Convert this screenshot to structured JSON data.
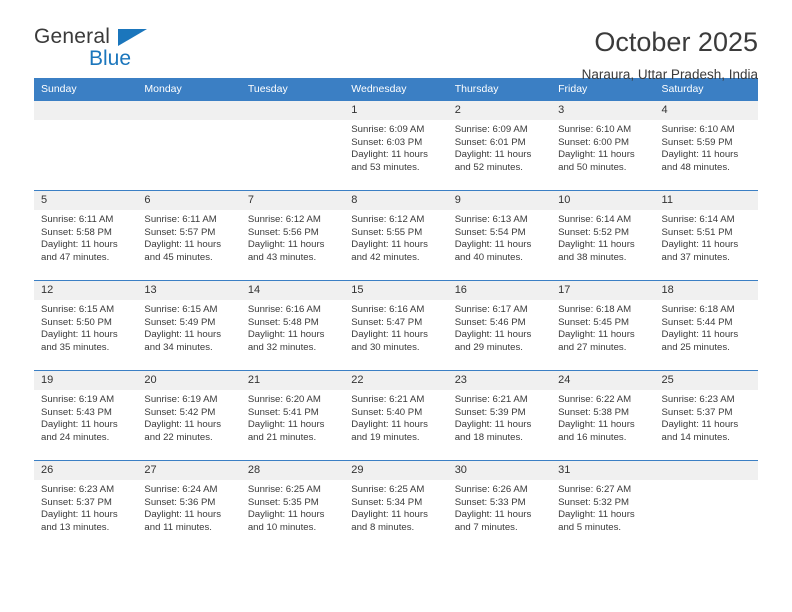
{
  "brand": {
    "name_part1": "General",
    "name_part2": "Blue",
    "triangle_color": "#1b76bc"
  },
  "header": {
    "title": "October 2025",
    "subtitle": "Naraura, Uttar Pradesh, India"
  },
  "theme": {
    "header_blue": "#3b7fc4",
    "daynum_bg": "#f0f0f0",
    "text": "#3a3a3a"
  },
  "weekdays": [
    "Sunday",
    "Monday",
    "Tuesday",
    "Wednesday",
    "Thursday",
    "Friday",
    "Saturday"
  ],
  "labels": {
    "sunrise": "Sunrise:",
    "sunset": "Sunset:",
    "daylight": "Daylight:"
  },
  "weeks": [
    [
      {
        "day": "",
        "sunrise": "",
        "sunset": "",
        "daylight1": "",
        "daylight2": ""
      },
      {
        "day": "",
        "sunrise": "",
        "sunset": "",
        "daylight1": "",
        "daylight2": ""
      },
      {
        "day": "",
        "sunrise": "",
        "sunset": "",
        "daylight1": "",
        "daylight2": ""
      },
      {
        "day": "1",
        "sunrise": "Sunrise: 6:09 AM",
        "sunset": "Sunset: 6:03 PM",
        "daylight1": "Daylight: 11 hours",
        "daylight2": "and 53 minutes."
      },
      {
        "day": "2",
        "sunrise": "Sunrise: 6:09 AM",
        "sunset": "Sunset: 6:01 PM",
        "daylight1": "Daylight: 11 hours",
        "daylight2": "and 52 minutes."
      },
      {
        "day": "3",
        "sunrise": "Sunrise: 6:10 AM",
        "sunset": "Sunset: 6:00 PM",
        "daylight1": "Daylight: 11 hours",
        "daylight2": "and 50 minutes."
      },
      {
        "day": "4",
        "sunrise": "Sunrise: 6:10 AM",
        "sunset": "Sunset: 5:59 PM",
        "daylight1": "Daylight: 11 hours",
        "daylight2": "and 48 minutes."
      }
    ],
    [
      {
        "day": "5",
        "sunrise": "Sunrise: 6:11 AM",
        "sunset": "Sunset: 5:58 PM",
        "daylight1": "Daylight: 11 hours",
        "daylight2": "and 47 minutes."
      },
      {
        "day": "6",
        "sunrise": "Sunrise: 6:11 AM",
        "sunset": "Sunset: 5:57 PM",
        "daylight1": "Daylight: 11 hours",
        "daylight2": "and 45 minutes."
      },
      {
        "day": "7",
        "sunrise": "Sunrise: 6:12 AM",
        "sunset": "Sunset: 5:56 PM",
        "daylight1": "Daylight: 11 hours",
        "daylight2": "and 43 minutes."
      },
      {
        "day": "8",
        "sunrise": "Sunrise: 6:12 AM",
        "sunset": "Sunset: 5:55 PM",
        "daylight1": "Daylight: 11 hours",
        "daylight2": "and 42 minutes."
      },
      {
        "day": "9",
        "sunrise": "Sunrise: 6:13 AM",
        "sunset": "Sunset: 5:54 PM",
        "daylight1": "Daylight: 11 hours",
        "daylight2": "and 40 minutes."
      },
      {
        "day": "10",
        "sunrise": "Sunrise: 6:14 AM",
        "sunset": "Sunset: 5:52 PM",
        "daylight1": "Daylight: 11 hours",
        "daylight2": "and 38 minutes."
      },
      {
        "day": "11",
        "sunrise": "Sunrise: 6:14 AM",
        "sunset": "Sunset: 5:51 PM",
        "daylight1": "Daylight: 11 hours",
        "daylight2": "and 37 minutes."
      }
    ],
    [
      {
        "day": "12",
        "sunrise": "Sunrise: 6:15 AM",
        "sunset": "Sunset: 5:50 PM",
        "daylight1": "Daylight: 11 hours",
        "daylight2": "and 35 minutes."
      },
      {
        "day": "13",
        "sunrise": "Sunrise: 6:15 AM",
        "sunset": "Sunset: 5:49 PM",
        "daylight1": "Daylight: 11 hours",
        "daylight2": "and 34 minutes."
      },
      {
        "day": "14",
        "sunrise": "Sunrise: 6:16 AM",
        "sunset": "Sunset: 5:48 PM",
        "daylight1": "Daylight: 11 hours",
        "daylight2": "and 32 minutes."
      },
      {
        "day": "15",
        "sunrise": "Sunrise: 6:16 AM",
        "sunset": "Sunset: 5:47 PM",
        "daylight1": "Daylight: 11 hours",
        "daylight2": "and 30 minutes."
      },
      {
        "day": "16",
        "sunrise": "Sunrise: 6:17 AM",
        "sunset": "Sunset: 5:46 PM",
        "daylight1": "Daylight: 11 hours",
        "daylight2": "and 29 minutes."
      },
      {
        "day": "17",
        "sunrise": "Sunrise: 6:18 AM",
        "sunset": "Sunset: 5:45 PM",
        "daylight1": "Daylight: 11 hours",
        "daylight2": "and 27 minutes."
      },
      {
        "day": "18",
        "sunrise": "Sunrise: 6:18 AM",
        "sunset": "Sunset: 5:44 PM",
        "daylight1": "Daylight: 11 hours",
        "daylight2": "and 25 minutes."
      }
    ],
    [
      {
        "day": "19",
        "sunrise": "Sunrise: 6:19 AM",
        "sunset": "Sunset: 5:43 PM",
        "daylight1": "Daylight: 11 hours",
        "daylight2": "and 24 minutes."
      },
      {
        "day": "20",
        "sunrise": "Sunrise: 6:19 AM",
        "sunset": "Sunset: 5:42 PM",
        "daylight1": "Daylight: 11 hours",
        "daylight2": "and 22 minutes."
      },
      {
        "day": "21",
        "sunrise": "Sunrise: 6:20 AM",
        "sunset": "Sunset: 5:41 PM",
        "daylight1": "Daylight: 11 hours",
        "daylight2": "and 21 minutes."
      },
      {
        "day": "22",
        "sunrise": "Sunrise: 6:21 AM",
        "sunset": "Sunset: 5:40 PM",
        "daylight1": "Daylight: 11 hours",
        "daylight2": "and 19 minutes."
      },
      {
        "day": "23",
        "sunrise": "Sunrise: 6:21 AM",
        "sunset": "Sunset: 5:39 PM",
        "daylight1": "Daylight: 11 hours",
        "daylight2": "and 18 minutes."
      },
      {
        "day": "24",
        "sunrise": "Sunrise: 6:22 AM",
        "sunset": "Sunset: 5:38 PM",
        "daylight1": "Daylight: 11 hours",
        "daylight2": "and 16 minutes."
      },
      {
        "day": "25",
        "sunrise": "Sunrise: 6:23 AM",
        "sunset": "Sunset: 5:37 PM",
        "daylight1": "Daylight: 11 hours",
        "daylight2": "and 14 minutes."
      }
    ],
    [
      {
        "day": "26",
        "sunrise": "Sunrise: 6:23 AM",
        "sunset": "Sunset: 5:37 PM",
        "daylight1": "Daylight: 11 hours",
        "daylight2": "and 13 minutes."
      },
      {
        "day": "27",
        "sunrise": "Sunrise: 6:24 AM",
        "sunset": "Sunset: 5:36 PM",
        "daylight1": "Daylight: 11 hours",
        "daylight2": "and 11 minutes."
      },
      {
        "day": "28",
        "sunrise": "Sunrise: 6:25 AM",
        "sunset": "Sunset: 5:35 PM",
        "daylight1": "Daylight: 11 hours",
        "daylight2": "and 10 minutes."
      },
      {
        "day": "29",
        "sunrise": "Sunrise: 6:25 AM",
        "sunset": "Sunset: 5:34 PM",
        "daylight1": "Daylight: 11 hours",
        "daylight2": "and 8 minutes."
      },
      {
        "day": "30",
        "sunrise": "Sunrise: 6:26 AM",
        "sunset": "Sunset: 5:33 PM",
        "daylight1": "Daylight: 11 hours",
        "daylight2": "and 7 minutes."
      },
      {
        "day": "31",
        "sunrise": "Sunrise: 6:27 AM",
        "sunset": "Sunset: 5:32 PM",
        "daylight1": "Daylight: 11 hours",
        "daylight2": "and 5 minutes."
      },
      {
        "day": "",
        "sunrise": "",
        "sunset": "",
        "daylight1": "",
        "daylight2": ""
      }
    ]
  ]
}
